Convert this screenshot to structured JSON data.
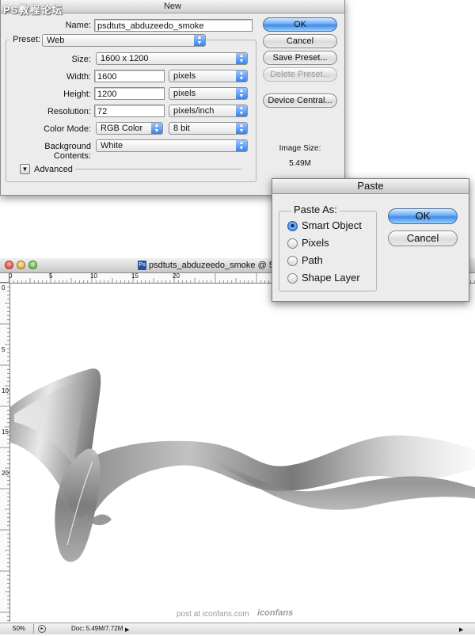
{
  "new_dialog": {
    "title": "New",
    "watermark": "PS教程论坛",
    "name_label": "Name:",
    "name_value": "psdtuts_abduzeedo_smoke",
    "preset_label": "Preset:",
    "preset_value": "Web",
    "size_label": "Size:",
    "size_value": "1600 x 1200",
    "width_label": "Width:",
    "width_value": "1600",
    "width_unit": "pixels",
    "height_label": "Height:",
    "height_value": "1200",
    "height_unit": "pixels",
    "resolution_label": "Resolution:",
    "resolution_value": "72",
    "resolution_unit": "pixels/inch",
    "color_mode_label": "Color Mode:",
    "color_mode_value": "RGB Color",
    "bit_depth_value": "8 bit",
    "background_label": "Background Contents:",
    "background_value": "White",
    "advanced_label": "Advanced",
    "image_size_label": "Image Size:",
    "image_size_value": "5.49M",
    "buttons": {
      "ok": "OK",
      "cancel": "Cancel",
      "save_preset": "Save Preset...",
      "delete_preset": "Delete Preset...",
      "device_central": "Device Central..."
    }
  },
  "paste_dialog": {
    "title": "Paste",
    "group_label": "Paste As:",
    "options": [
      "Smart Object",
      "Pixels",
      "Path",
      "Shape Layer"
    ],
    "selected_index": 0,
    "ok": "OK",
    "cancel": "Cancel"
  },
  "document": {
    "title": "psdtuts_abduzeedo_smoke @ 50%",
    "hruler_labels": [
      "0",
      "5",
      "10",
      "15",
      "20"
    ],
    "vruler_labels": [
      "0",
      "5",
      "10",
      "15",
      "20"
    ],
    "zoom": "50%",
    "doc_info": "Doc: 5.49M/7.72M",
    "credit": "post at iconfans.com",
    "credit_logo": "iconfans"
  },
  "colors": {
    "aqua_blue": "#3f8ae8",
    "dialog_bg": "#ececec",
    "smoke_dark": "#6e6e6e",
    "smoke_light": "#f2f2f2"
  }
}
